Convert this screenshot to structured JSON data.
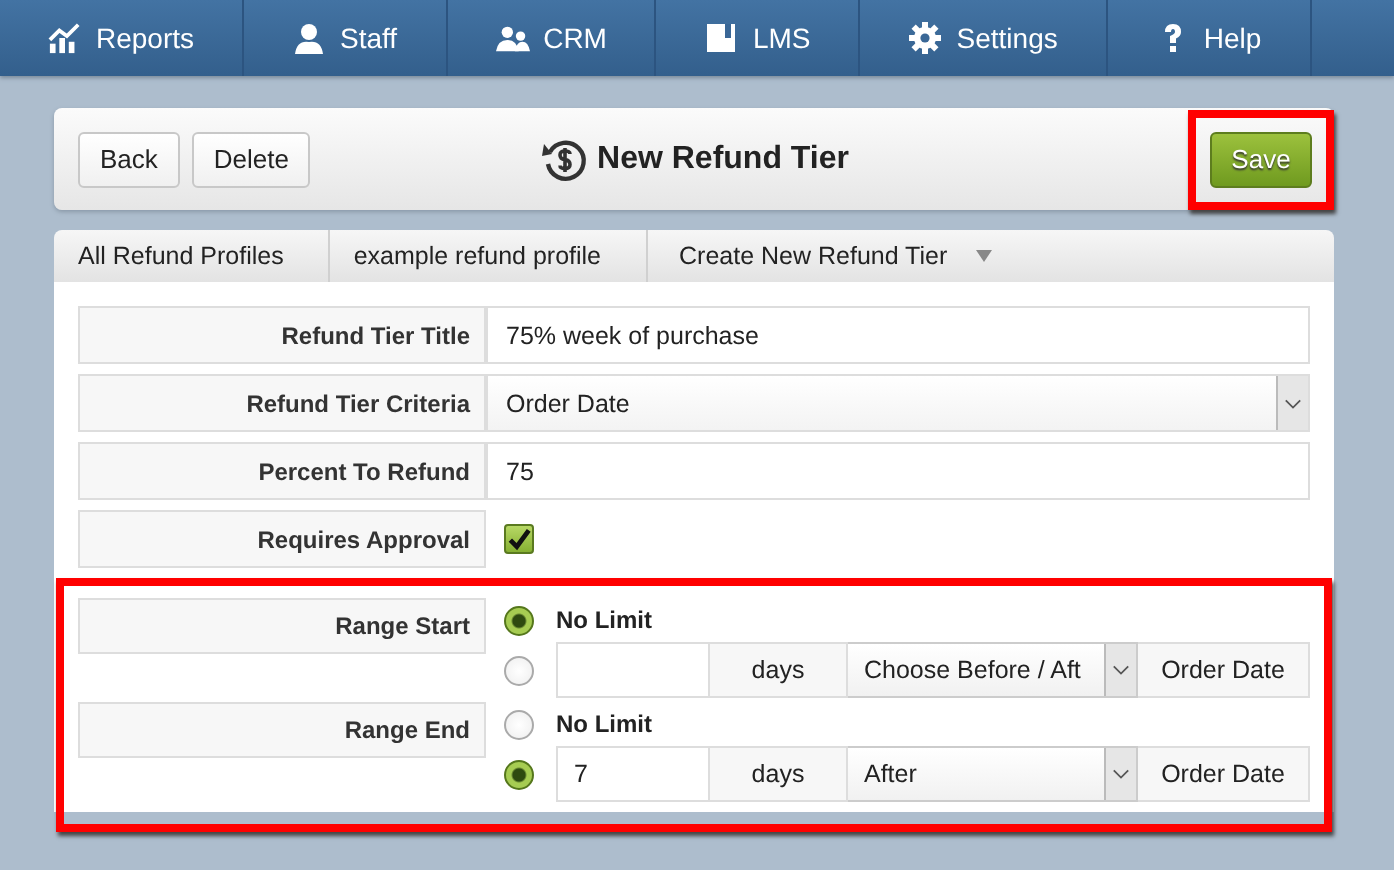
{
  "nav": [
    {
      "kind": "chart",
      "label": "Reports"
    },
    {
      "kind": "person",
      "label": "Staff"
    },
    {
      "kind": "people",
      "label": "CRM"
    },
    {
      "kind": "book",
      "label": "LMS"
    },
    {
      "kind": "gear",
      "label": "Settings"
    },
    {
      "kind": "help",
      "label": "Help"
    }
  ],
  "header": {
    "buttons": [
      "Back",
      "Delete"
    ],
    "title": "New Refund Tier",
    "save": {
      "label": "Save",
      "highlighted": true
    }
  },
  "breadcrumb": [
    {
      "label": "All Refund Profiles",
      "caret": false
    },
    {
      "label": "example refund profile",
      "caret": false
    },
    {
      "label": "Create New Refund Tier",
      "caret": true
    }
  ],
  "fields": [
    {
      "kind": "text",
      "label": "Refund Tier Title",
      "value": "75% week of purchase"
    },
    {
      "kind": "select",
      "label": "Refund Tier Criteria",
      "value": "Order Date"
    },
    {
      "kind": "text",
      "label": "Percent To Refund",
      "value": "75"
    },
    {
      "kind": "checkbox",
      "label": "Requires Approval",
      "checked": true
    }
  ],
  "ranges": {
    "highlighted": true,
    "items": [
      {
        "label": "Range Start",
        "options": [
          {
            "kind": "none",
            "label": "No Limit",
            "selected": true
          },
          {
            "kind": "custom",
            "selected": false,
            "unit": "days",
            "direction": "Choose Before / Aft",
            "reference": "Order Date"
          }
        ]
      },
      {
        "label": "Range End",
        "options": [
          {
            "kind": "none",
            "label": "No Limit",
            "selected": false
          },
          {
            "kind": "custom",
            "selected": true,
            "amount": "7",
            "unit": "days",
            "direction": "After",
            "reference": "Order Date"
          }
        ]
      }
    ]
  }
}
